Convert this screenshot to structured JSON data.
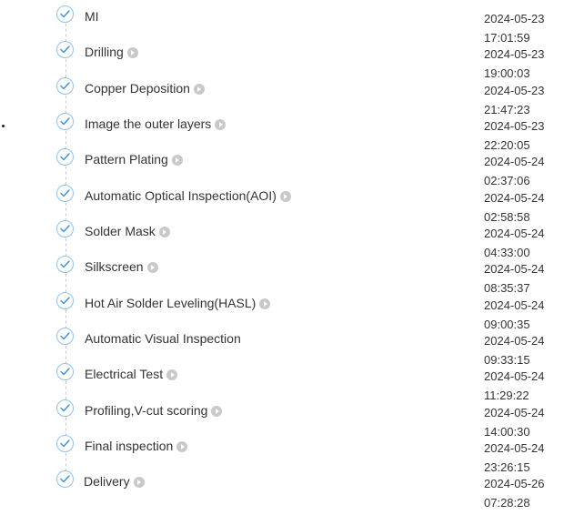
{
  "progress": {
    "steps": [
      {
        "name": "MI",
        "date": "2024-05-23",
        "time": "17:01:59",
        "has_play": false
      },
      {
        "name": "Drilling",
        "date": "2024-05-23",
        "time": "19:00:03",
        "has_play": true
      },
      {
        "name": "Copper Deposition",
        "date": "2024-05-23",
        "time": "21:47:23",
        "has_play": true
      },
      {
        "name": "Image the outer layers",
        "date": "2024-05-23",
        "time": "22:20:05",
        "has_play": true
      },
      {
        "name": "Pattern Plating",
        "date": "2024-05-24",
        "time": "02:37:06",
        "has_play": true
      },
      {
        "name": "Automatic Optical Inspection(AOI)",
        "date": "2024-05-24",
        "time": "02:58:58",
        "has_play": true
      },
      {
        "name": "Solder Mask",
        "date": "2024-05-24",
        "time": "04:33:00",
        "has_play": true
      },
      {
        "name": "Silkscreen",
        "date": "2024-05-24",
        "time": "08:35:37",
        "has_play": true
      },
      {
        "name": "Hot Air Solder Leveling(HASL)",
        "date": "2024-05-24",
        "time": "09:00:35",
        "has_play": true
      },
      {
        "name": "Automatic Visual Inspection",
        "date": "2024-05-24",
        "time": "09:33:15",
        "has_play": false
      },
      {
        "name": "Electrical Test",
        "date": "2024-05-24",
        "time": "11:29:22",
        "has_play": true
      },
      {
        "name": "Profiling,V-cut scoring",
        "date": "2024-05-24",
        "time": "14:00:30",
        "has_play": true
      },
      {
        "name": "Final inspection",
        "date": "2024-05-24",
        "time": "23:26:15",
        "has_play": true
      },
      {
        "name": "Delivery",
        "date": "2024-05-26",
        "time": "07:28:28",
        "has_play": true
      }
    ],
    "colors": {
      "check_border": "#8fc2ee",
      "check_mark": "#3d8fd8",
      "play_icon": "#c9c9c9",
      "text": "#333333"
    }
  }
}
